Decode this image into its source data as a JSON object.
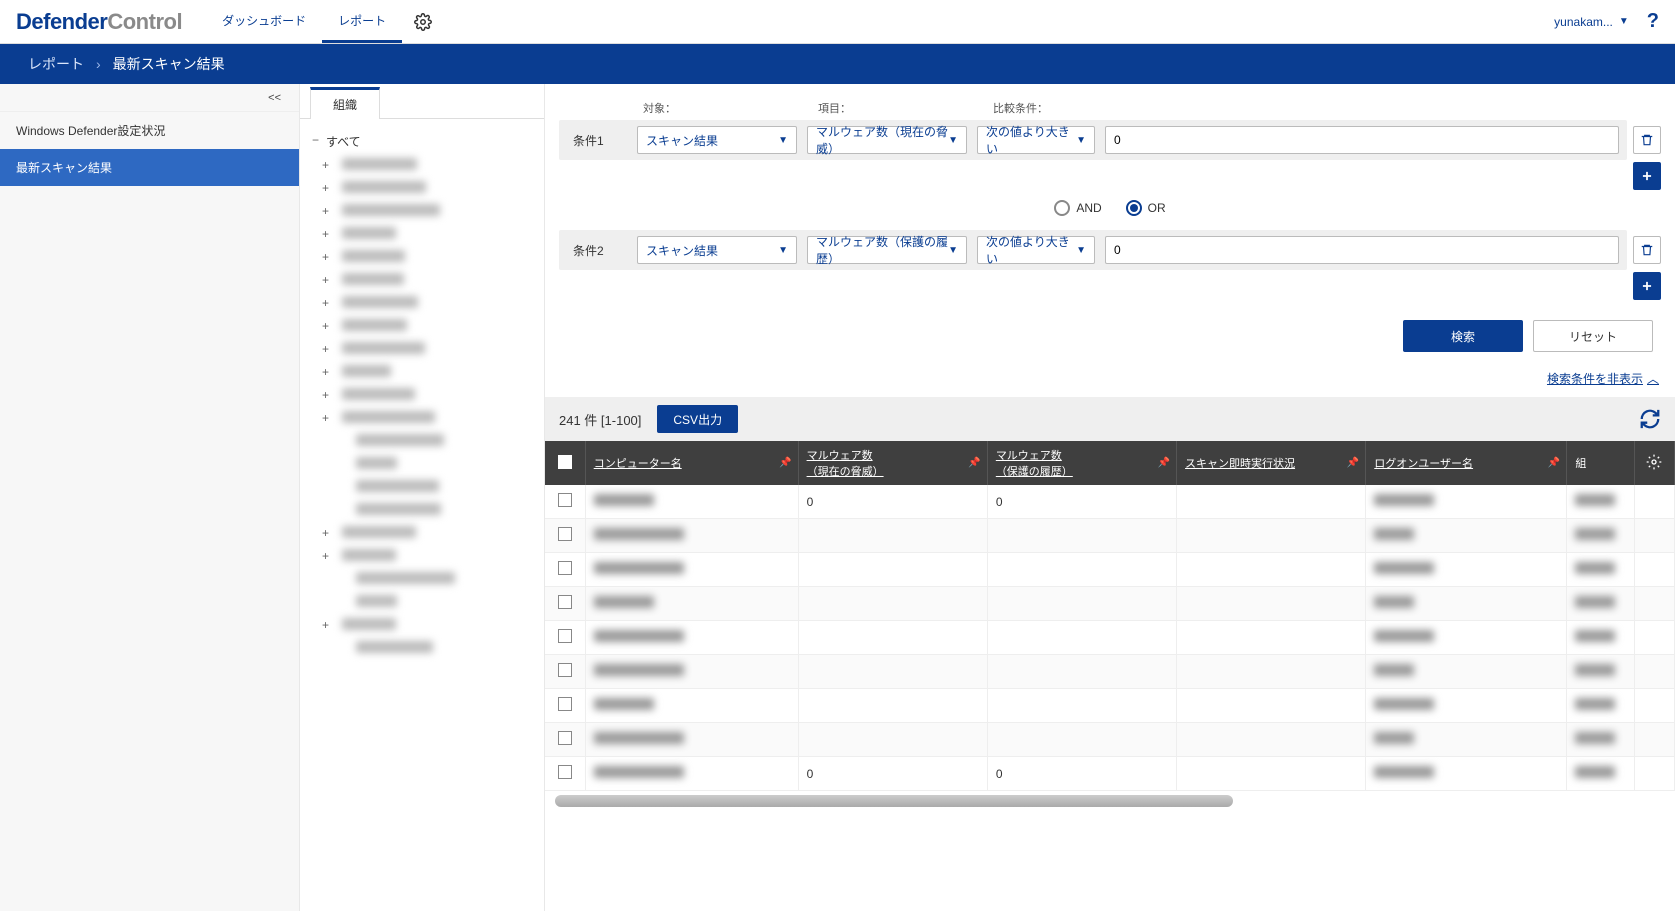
{
  "header": {
    "logo_left": "Defender",
    "logo_right": "Control",
    "nav": {
      "dashboard": "ダッシュボード",
      "report": "レポート"
    },
    "user": "yunakam...",
    "help": "?"
  },
  "breadcrumb": {
    "root": "レポート",
    "current": "最新スキャン結果"
  },
  "leftnav": {
    "collapse": "<<",
    "items": [
      {
        "label": "Windows Defender設定状況",
        "active": false
      },
      {
        "label": "最新スキャン結果",
        "active": true
      }
    ]
  },
  "tree": {
    "tab": "組織",
    "root": "すべて",
    "nodes": [
      {
        "expandable": true
      },
      {
        "expandable": true
      },
      {
        "expandable": true
      },
      {
        "expandable": true
      },
      {
        "expandable": true
      },
      {
        "expandable": true
      },
      {
        "expandable": true
      },
      {
        "expandable": true
      },
      {
        "expandable": true
      },
      {
        "expandable": true
      },
      {
        "expandable": true
      },
      {
        "expandable": true
      },
      {
        "expandable": false,
        "child": true
      },
      {
        "expandable": false,
        "child": true
      },
      {
        "expandable": false,
        "child": true
      },
      {
        "expandable": false,
        "child": true
      },
      {
        "expandable": true
      },
      {
        "expandable": true
      },
      {
        "expandable": false,
        "child": true
      },
      {
        "expandable": false,
        "child": true
      },
      {
        "expandable": true
      },
      {
        "expandable": false,
        "child": true
      }
    ]
  },
  "filter": {
    "labels": {
      "target": "対象：",
      "field": "項目：",
      "compare": "比較条件："
    },
    "conditions": [
      {
        "label": "条件1",
        "target": "スキャン結果",
        "field": "マルウェア数（現在の脅威）",
        "compare": "次の値より大きい",
        "value": "0"
      },
      {
        "label": "条件2",
        "target": "スキャン結果",
        "field": "マルウェア数（保護の履歴）",
        "compare": "次の値より大きい",
        "value": "0"
      }
    ],
    "logic": {
      "and": "AND",
      "or": "OR",
      "selected": "or"
    },
    "buttons": {
      "search": "検索",
      "reset": "リセット"
    },
    "toggle": "検索条件を非表示"
  },
  "results": {
    "count_text": "241 件 [1-100]",
    "csv": "CSV出力",
    "columns": {
      "computer": "コンピューター名",
      "malware_current": "マルウェア数\n（現在の脅威）",
      "malware_history": "マルウェア数\n（保護の履歴）",
      "scan_status": "スキャン即時実行状況",
      "logon_user": "ログオンユーザー名",
      "org": "組"
    },
    "rows": [
      {
        "current": "0",
        "history": "0"
      },
      {
        "current": "",
        "history": ""
      },
      {
        "current": "",
        "history": ""
      },
      {
        "current": "",
        "history": ""
      },
      {
        "current": "",
        "history": ""
      },
      {
        "current": "",
        "history": ""
      },
      {
        "current": "",
        "history": ""
      },
      {
        "current": "",
        "history": ""
      },
      {
        "current": "0",
        "history": "0"
      }
    ]
  }
}
